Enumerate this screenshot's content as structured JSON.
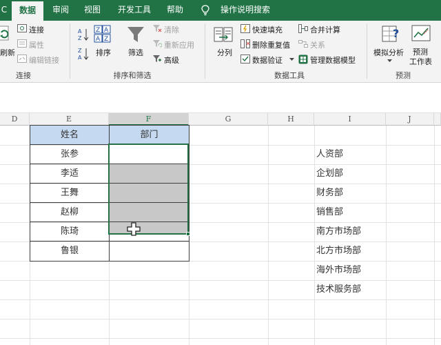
{
  "tabs": {
    "partial": "C",
    "data": "数据",
    "review": "审阅",
    "view": "视图",
    "developer": "开发工具",
    "help": "帮助",
    "tell_me": "操作说明搜索"
  },
  "ribbon": {
    "refresh_partial": "刷新",
    "connections": "连接",
    "properties": "属性",
    "edit_links": "编辑链接",
    "group_connections": "连接",
    "sort_az_icon": "A→Z",
    "sort_za_icon": "Z→A",
    "sort": "排序",
    "filter": "筛选",
    "clear": "清除",
    "reapply": "重新应用",
    "advanced": "高级",
    "group_sort_filter": "排序和筛选",
    "text_to_columns": "分列",
    "flash_fill": "快速填充",
    "remove_duplicates": "删除重复值",
    "data_validation": "数据验证",
    "consolidate": "合并计算",
    "relationships": "关系",
    "manage_data_model": "管理数据模型",
    "group_data_tools": "数据工具",
    "what_if": "模拟分析",
    "forecast_line1": "预测",
    "forecast_line2": "工作表",
    "group_forecast": "预测"
  },
  "columns": [
    "D",
    "E",
    "F",
    "G",
    "H",
    "I",
    "J"
  ],
  "table": {
    "header_name": "姓名",
    "header_dept": "部门",
    "names": [
      "张参",
      "李适",
      "王舞",
      "赵柳",
      "陈琦",
      "鲁银"
    ]
  },
  "departments": [
    "人资部",
    "企划部",
    "财务部",
    "销售部",
    "南方市场部",
    "北方市场部",
    "海外市场部",
    "技术服务部"
  ],
  "colors": {
    "excel_green": "#217346",
    "header_fill": "#c5d9f1",
    "selection_fill": "#c8c8c8"
  }
}
